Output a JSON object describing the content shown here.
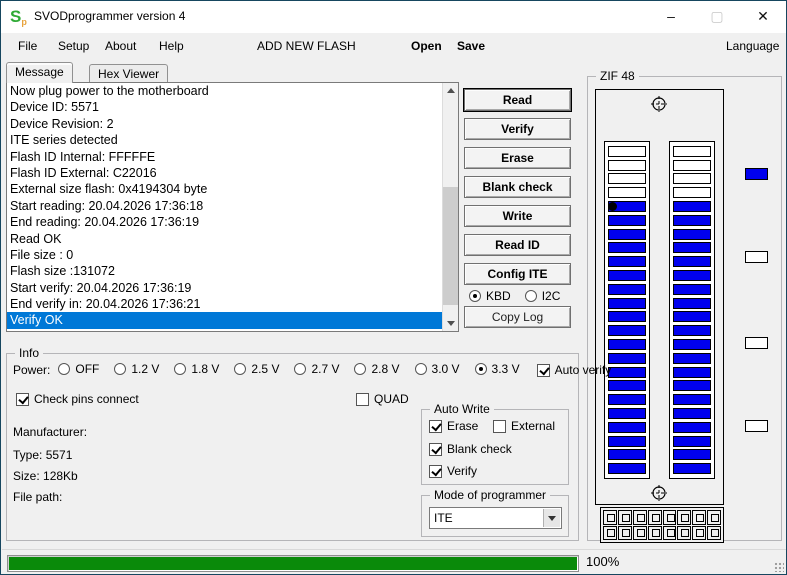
{
  "window": {
    "title": "SVODprogrammer version 4",
    "icon_letter": "S",
    "icon_sub": "p",
    "minimize_glyph": "–",
    "maximize_glyph": "▢",
    "close_glyph": "✕"
  },
  "menu": {
    "file": "File",
    "setup": "Setup",
    "about": "About",
    "help": "Help",
    "add_new_flash": "ADD NEW FLASH",
    "open": "Open",
    "save": "Save",
    "language": "Language"
  },
  "tabs": {
    "message": "Message",
    "hex_viewer": "Hex Viewer",
    "active": "Message"
  },
  "log": {
    "lines": [
      "Now plug power to the motherboard",
      "Device ID: 5571",
      "Device Revision: 2",
      "ITE series detected",
      "Flash ID Internal: FFFFFE",
      "Flash ID External: C22016",
      "External size flash: 0x4194304 byte",
      "Start reading: 20.04.2026 17:36:18",
      "End reading: 20.04.2026 17:36:19",
      "Read OK",
      "File size : 0",
      "Flash size :131072",
      "Start verify: 20.04.2026 17:36:19",
      "End verify in: 20.04.2026 17:36:21",
      "Verify OK"
    ],
    "selected_index": 14
  },
  "actions": {
    "buttons": [
      "Read",
      "Verify",
      "Erase",
      "Blank check",
      "Write",
      "Read ID",
      "Config ITE"
    ],
    "default_button": "Read",
    "interface_radios": [
      {
        "label": "KBD",
        "selected": true
      },
      {
        "label": "I2C",
        "selected": false
      }
    ],
    "copy_log": "Copy Log"
  },
  "zif": {
    "title": "ZIF 48",
    "pins_per_column": 24,
    "empty_top_slots": 4,
    "pin1_slot_index": 4,
    "indicators": [
      "filled",
      "empty",
      "empty",
      "empty"
    ],
    "connector_rows": 2,
    "connector_cols": 8
  },
  "info": {
    "title": "Info",
    "power": {
      "label": "Power:",
      "options": [
        "OFF",
        "1.2 V",
        "1.8 V",
        "2.5 V",
        "2.7 V",
        "2.8 V",
        "3.0 V",
        "3.3 V"
      ],
      "selected": "3.3 V"
    },
    "auto_verify": {
      "label": "Auto verify",
      "checked": true
    },
    "check_pins": {
      "label": "Check pins connect",
      "checked": true
    },
    "quad": {
      "label": "QUAD",
      "checked": false
    },
    "fields": [
      {
        "label": "Manufacturer:",
        "value": ""
      },
      {
        "label": "Type:",
        "value": "5571"
      },
      {
        "label": "Size:",
        "value": "128Kb"
      },
      {
        "label": "File path:",
        "value": ""
      }
    ]
  },
  "auto_write": {
    "title": "Auto Write",
    "items": [
      {
        "label": "Erase",
        "checked": true
      },
      {
        "label": "External",
        "checked": false
      },
      {
        "label": "Blank check",
        "checked": true
      },
      {
        "label": "Verify",
        "checked": true
      }
    ]
  },
  "mode": {
    "title": "Mode of programmer",
    "value": "ITE"
  },
  "status": {
    "progress_percent": 100,
    "progress_label": "100%"
  },
  "colors": {
    "window_border": "#16465f",
    "selection_blue": "#0078d7",
    "pin_blue": "#0000ee",
    "progress_green": "#0a8a0a"
  }
}
